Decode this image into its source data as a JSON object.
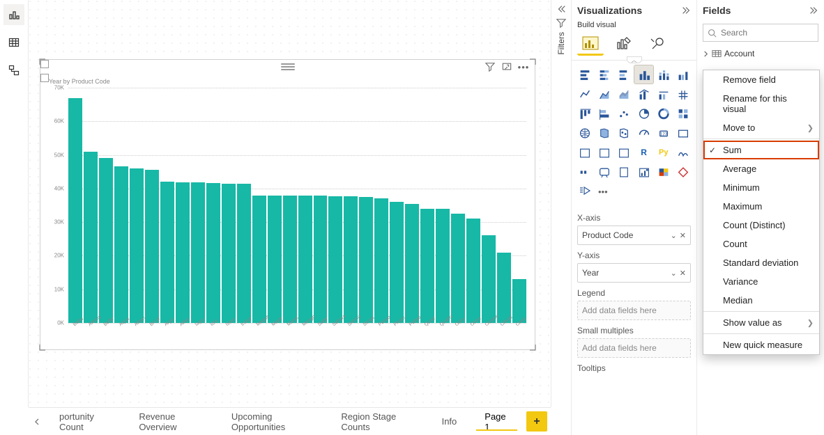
{
  "chart_data": {
    "type": "bar",
    "title": "Year by Product Code",
    "ylabel": "",
    "xlabel": "",
    "ylim": [
      0,
      70000
    ],
    "y_ticks": [
      "70K",
      "60K",
      "50K",
      "40K",
      "30K",
      "20K",
      "10K",
      "0K"
    ],
    "categories": [
      "Babu",
      "Alexus",
      "Belfo",
      "Aqua",
      "Alban",
      "Bruni",
      "Argo",
      "Aliko",
      "Iago",
      "Idro",
      "Istan",
      "Indus",
      "Magus",
      "Major",
      "Manis",
      "Mango",
      "Sabir",
      "Sahara",
      "Sienna",
      "Strata",
      "Paseo",
      "Pharo",
      "Palma",
      "Quad",
      "Quattro",
      "Odin",
      "Orion",
      "Octane",
      "Cibola",
      "Crest"
    ],
    "values": [
      67000,
      51000,
      49000,
      46500,
      46000,
      45500,
      42000,
      41800,
      41800,
      41700,
      41500,
      41500,
      38000,
      38000,
      37800,
      37800,
      37800,
      37600,
      37600,
      37500,
      37000,
      36000,
      35500,
      34000,
      34000,
      32500,
      31000,
      26000,
      21000,
      13000
    ]
  },
  "visual_topbar": {
    "filter_tooltip": "Filter",
    "focus_tooltip": "Focus mode",
    "more_tooltip": "More options"
  },
  "pages": {
    "tabs": [
      "portunity Count",
      "Revenue Overview",
      "Upcoming Opportunities",
      "Region Stage Counts",
      "Info",
      "Page 1"
    ],
    "active_index": 5
  },
  "filters_pane": {
    "label": "Filters"
  },
  "viz_pane": {
    "title": "Visualizations",
    "build_label": "Build visual",
    "wells": {
      "xaxis": {
        "label": "X-axis",
        "value": "Product Code"
      },
      "yaxis": {
        "label": "Y-axis",
        "value": "Year"
      },
      "legend": {
        "label": "Legend",
        "placeholder": "Add data fields here"
      },
      "small_mult": {
        "label": "Small multiples",
        "placeholder": "Add data fields here"
      },
      "tooltips": {
        "label": "Tooltips"
      }
    }
  },
  "fields_pane": {
    "title": "Fields",
    "search_placeholder": "Search",
    "tables": [
      "Account"
    ]
  },
  "ctx_menu": {
    "items": [
      {
        "label": "Remove field"
      },
      {
        "label": "Rename for this visual"
      },
      {
        "label": "Move to",
        "submenu": true
      },
      {
        "sep": true
      },
      {
        "label": "Sum",
        "checked": true,
        "highlight": true
      },
      {
        "label": "Average"
      },
      {
        "label": "Minimum"
      },
      {
        "label": "Maximum"
      },
      {
        "label": "Count (Distinct)"
      },
      {
        "label": "Count"
      },
      {
        "label": "Standard deviation"
      },
      {
        "label": "Variance"
      },
      {
        "label": "Median"
      },
      {
        "sep": true
      },
      {
        "label": "Show value as",
        "submenu": true
      },
      {
        "sep": true
      },
      {
        "label": "New quick measure"
      }
    ]
  }
}
